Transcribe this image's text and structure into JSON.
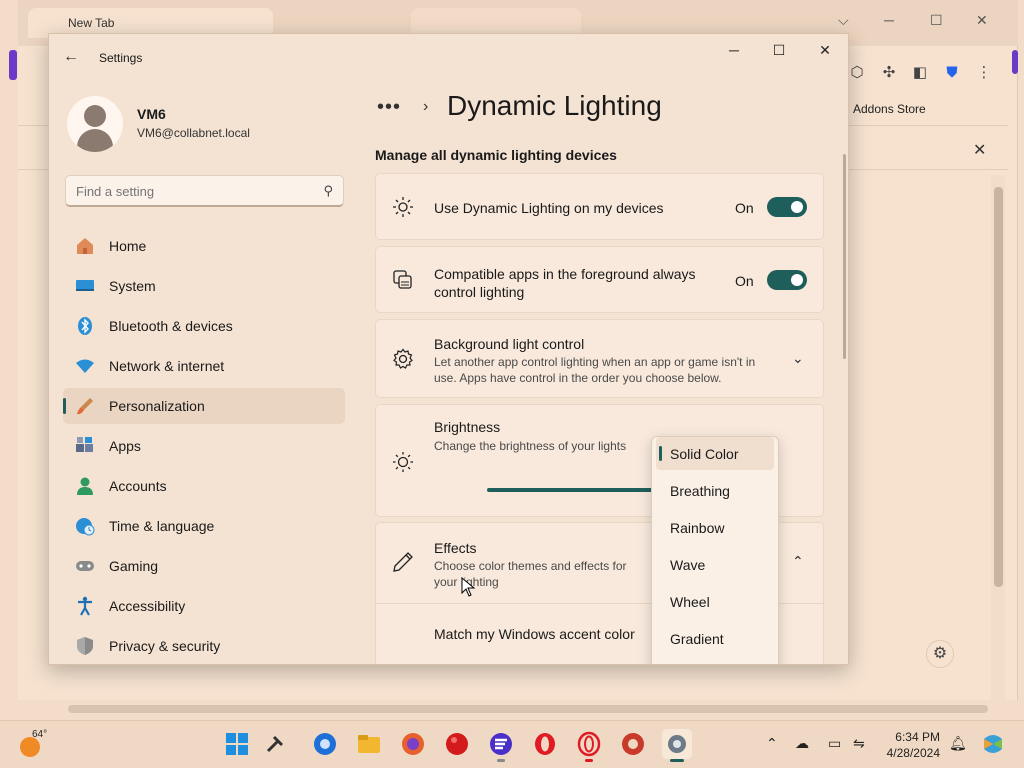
{
  "browser": {
    "tab_title": "New Tab",
    "addons_label": "Addons Store"
  },
  "settings": {
    "app_title": "Settings",
    "user": {
      "name": "VM6",
      "email": "VM6@collabnet.local"
    },
    "search_placeholder": "Find a setting",
    "nav": [
      {
        "label": "Home",
        "icon": "home-icon"
      },
      {
        "label": "System",
        "icon": "monitor-icon"
      },
      {
        "label": "Bluetooth & devices",
        "icon": "bluetooth-icon"
      },
      {
        "label": "Network & internet",
        "icon": "wifi-icon"
      },
      {
        "label": "Personalization",
        "icon": "brush-icon",
        "active": true
      },
      {
        "label": "Apps",
        "icon": "apps-icon"
      },
      {
        "label": "Accounts",
        "icon": "person-icon"
      },
      {
        "label": "Time & language",
        "icon": "globe-clock-icon"
      },
      {
        "label": "Gaming",
        "icon": "gamepad-icon"
      },
      {
        "label": "Accessibility",
        "icon": "accessibility-icon"
      },
      {
        "label": "Privacy & security",
        "icon": "shield-icon"
      }
    ],
    "breadcrumb_dots": "•••",
    "page_title": "Dynamic Lighting",
    "section_title": "Manage all dynamic lighting devices",
    "cards": {
      "use_dynamic": {
        "title": "Use Dynamic Lighting on my devices",
        "state": "On"
      },
      "compatible_apps": {
        "title": "Compatible apps in the foreground always control lighting",
        "state": "On"
      },
      "background": {
        "title": "Background light control",
        "desc": "Let another app control lighting when an app or game isn't in use. Apps have control in the order you choose below."
      },
      "brightness": {
        "title": "Brightness",
        "desc": "Change the brightness of your lights",
        "value": 100
      },
      "effects": {
        "title": "Effects",
        "desc": "Choose color themes and effects for your lighting"
      },
      "match_accent": {
        "title": "Match my Windows accent color"
      }
    },
    "effects_dropdown": {
      "options": [
        "Solid Color",
        "Breathing",
        "Rainbow",
        "Wave",
        "Wheel",
        "Gradient"
      ],
      "selected": "Solid Color"
    }
  },
  "taskbar": {
    "weather_temp": "64°",
    "time": "6:34 PM",
    "date": "4/28/2024"
  },
  "colors": {
    "accent": "#1f5f5b",
    "window_bg": "#f4e3d3"
  }
}
